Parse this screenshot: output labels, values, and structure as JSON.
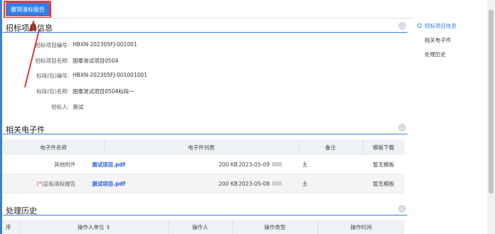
{
  "toolbar": {
    "revoke_label": "撤销清标报告"
  },
  "sections": {
    "project_info": "招标项目信息",
    "e_files": "相关电子件",
    "history": "处理历史"
  },
  "project_info": [
    {
      "label": "招标项目编号:",
      "value": "HBXN-202305FJ-001001"
    },
    {
      "label": "招标项目名称:",
      "value": "国泰测试项目0504"
    },
    {
      "label": "标段(包)编号:",
      "value": "HBXN-202305FJ-001001001"
    },
    {
      "label": "标段(包)名称:",
      "value": "国泰测试项目0504标段一"
    },
    {
      "label": "招标人:",
      "value": "测试"
    }
  ],
  "efiles_table": {
    "headers": [
      "电子件名称",
      "电子件列表",
      "备注",
      "模板下载"
    ],
    "rows": [
      {
        "name": "其他附件",
        "required": "",
        "file": "测试项目.pdf",
        "size": "200 KB",
        "date": "2023-05-09",
        "template": "暂无模板"
      },
      {
        "name": "定标清标报告",
        "required": "(*)",
        "file": "测试项目.pdf",
        "size": "200 KB",
        "date": "2023-05-08",
        "template": "暂无模板"
      }
    ]
  },
  "history_table": {
    "headers": [
      "序",
      "操作人单位 ⇕",
      "操作人",
      "操作类型",
      "操作时间"
    ]
  },
  "nav": {
    "items": [
      "招标项目信息",
      "相关电子件",
      "处理历史"
    ]
  },
  "colors": {
    "accent": "#2f80e8",
    "annotation": "#e53935"
  },
  "icons": {
    "collapse": "chevron-up-icon",
    "download": "download-icon"
  }
}
